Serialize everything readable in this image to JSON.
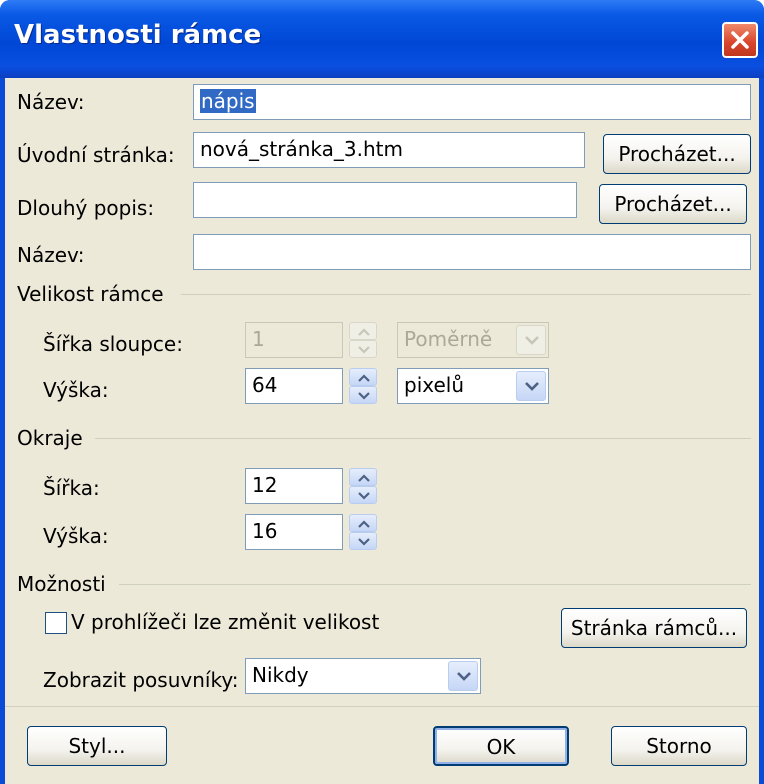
{
  "window": {
    "title": "Vlastnosti rámce"
  },
  "fields": {
    "name_label": "Název:",
    "name_value": "nápis",
    "start_page_label": "Úvodní stránka:",
    "start_page_value": "nová_stránka_3.htm",
    "browse_label": "Procházet...",
    "long_desc_label": "Dlouhý popis:",
    "long_desc_value": "",
    "title_label": "Název:",
    "title_value": ""
  },
  "frame_size": {
    "group_label": "Velikost rámce",
    "column_width_label": "Šířka sloupce:",
    "column_width_value": "1",
    "column_width_unit": "Poměrně",
    "height_label": "Výška:",
    "height_value": "64",
    "height_unit": "pixelů"
  },
  "margins": {
    "group_label": "Okraje",
    "width_label": "Šířka:",
    "width_value": "12",
    "height_label": "Výška:",
    "height_value": "16"
  },
  "options": {
    "group_label": "Možnosti",
    "resize_label": "V prohlížeči lze změnit velikost",
    "resize_checked": false,
    "frames_page_button": "Stránka rámců...",
    "scrollbars_label": "Zobrazit posuvníky:",
    "scrollbars_value": "Nikdy"
  },
  "buttons": {
    "style": "Styl...",
    "ok": "OK",
    "cancel": "Storno"
  },
  "colors": {
    "titlebar": "#0047d6",
    "dialog_bg": "#ece9d8",
    "selection": "#316ac5",
    "close": "#d8432c"
  }
}
